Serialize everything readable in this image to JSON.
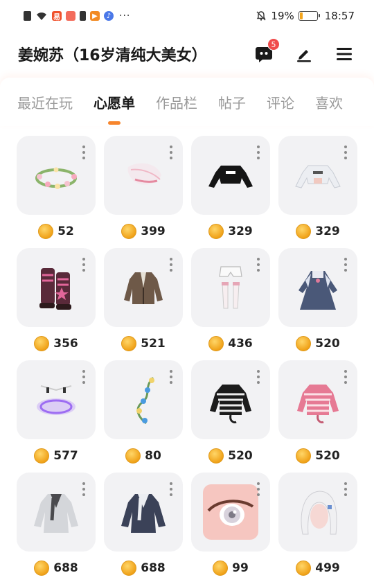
{
  "status_bar": {
    "battery": "19%",
    "time": "18:57",
    "battery_level": 0.19,
    "dots": "···"
  },
  "header": {
    "title": "姜婉苏（16岁清纯大美女）",
    "message_badge": "5"
  },
  "tabs": [
    {
      "label": "最近在玩",
      "active": false
    },
    {
      "label": "心愿单",
      "active": true
    },
    {
      "label": "作品栏",
      "active": false
    },
    {
      "label": "帖子",
      "active": false
    },
    {
      "label": "评论",
      "active": false
    },
    {
      "label": "喜欢",
      "active": false
    }
  ],
  "items": [
    {
      "icon": "flower-crown-icon",
      "price": "52"
    },
    {
      "icon": "feather-wing-icon",
      "price": "399"
    },
    {
      "icon": "black-crop-hoodie-icon",
      "price": "329"
    },
    {
      "icon": "white-crop-hoodie-icon",
      "price": "329"
    },
    {
      "icon": "star-leg-warmers-icon",
      "price": "356"
    },
    {
      "icon": "brown-blazer-icon",
      "price": "521"
    },
    {
      "icon": "shorts-and-stockings-icon",
      "price": "436"
    },
    {
      "icon": "navy-dress-icon",
      "price": "520"
    },
    {
      "icon": "glowing-halo-icon",
      "price": "577"
    },
    {
      "icon": "flower-vine-icon",
      "price": "80"
    },
    {
      "icon": "striped-black-sweater-icon",
      "price": "520"
    },
    {
      "icon": "striped-pink-sweater-icon",
      "price": "520"
    },
    {
      "icon": "grey-jacket-icon",
      "price": "688"
    },
    {
      "icon": "navy-jacket-icon",
      "price": "688"
    },
    {
      "icon": "pink-eye-icon",
      "price": "99"
    },
    {
      "icon": "white-hair-icon",
      "price": "499"
    }
  ],
  "colors": {
    "accent": "#f7852c",
    "badge": "#f04b4b",
    "coin": "#f0a219",
    "card_bg": "#f2f2f4"
  }
}
